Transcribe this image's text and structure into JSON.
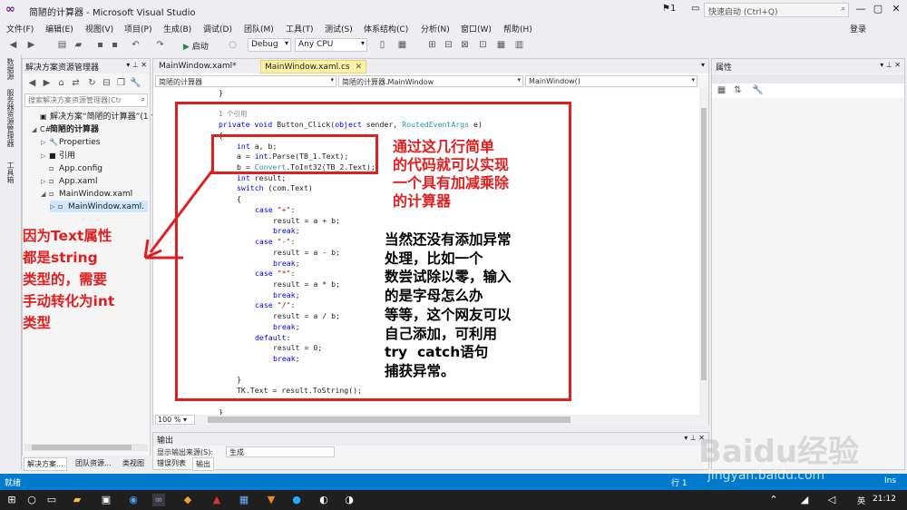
{
  "window": {
    "title": "简陋的计算器 - Microsoft Visual Studio",
    "flag_count": "1",
    "quick_launch_placeholder": "快速启动 (Ctrl+Q)",
    "login": "登录"
  },
  "menu": [
    "文件(F)",
    "编辑(E)",
    "视图(V)",
    "项目(P)",
    "生成(B)",
    "调试(D)",
    "团队(M)",
    "工具(T)",
    "测试(S)",
    "体系结构(C)",
    "分析(N)",
    "窗口(W)",
    "帮助(H)"
  ],
  "toolbar": {
    "start_label": "启动",
    "config": "Debug",
    "platform": "Any CPU"
  },
  "left_strip": [
    "数据源",
    "服务器资源管理器",
    "工具箱"
  ],
  "solution_explorer": {
    "title": "解决方案资源管理器",
    "search_placeholder": "搜索解决方案资源管理器(Ctr",
    "items": [
      {
        "label": "解决方案“简陋的计算器”(1 个",
        "arrow": "",
        "icon": "▣",
        "indent": 0
      },
      {
        "label": "简陋的计算器",
        "arrow": "◢",
        "icon": "C#",
        "indent": 0,
        "bold": true
      },
      {
        "label": "Properties",
        "arrow": "▷",
        "icon": "🔧",
        "indent": 1
      },
      {
        "label": "引用",
        "arrow": "▷",
        "icon": "■",
        "indent": 1
      },
      {
        "label": "App.config",
        "arrow": "",
        "icon": "▫",
        "indent": 1
      },
      {
        "label": "App.xaml",
        "arrow": "▷",
        "icon": "▫",
        "indent": 1
      },
      {
        "label": "MainWindow.xaml",
        "arrow": "◢",
        "icon": "▫",
        "indent": 1
      },
      {
        "label": "MainWindow.xaml.",
        "arrow": "▷",
        "icon": "▫",
        "indent": 2,
        "selected": true
      }
    ],
    "tabs": [
      "解决方案...",
      "团队资源...",
      "类视图"
    ]
  },
  "editor": {
    "tabs": [
      {
        "label": "MainWindow.xaml*",
        "active": false
      },
      {
        "label": "MainWindow.xaml.cs",
        "active": true
      }
    ],
    "nav": [
      "简陋的计算器",
      "简陋的计算器.MainWindow",
      "MainWindow()"
    ],
    "zoom": "100 %",
    "code": [
      {
        "indent": 4,
        "parts": [
          {
            "t": "}"
          }
        ]
      },
      {
        "indent": 0,
        "parts": [
          {
            "t": ""
          }
        ]
      },
      {
        "indent": 4,
        "parts": [
          {
            "t": "1 个引用",
            "c": "ref"
          }
        ]
      },
      {
        "indent": 4,
        "parts": [
          {
            "t": "private void ",
            "c": "kw"
          },
          {
            "t": "Button_Click("
          },
          {
            "t": "object",
            "c": "kw"
          },
          {
            "t": " sender, "
          },
          {
            "t": "RoutedEventArgs",
            "c": "ty"
          },
          {
            "t": " e)"
          }
        ]
      },
      {
        "indent": 4,
        "parts": [
          {
            "t": "{"
          }
        ]
      },
      {
        "indent": 8,
        "parts": [
          {
            "t": "int",
            "c": "kw"
          },
          {
            "t": " a, b;"
          }
        ]
      },
      {
        "indent": 8,
        "parts": [
          {
            "t": "a = "
          },
          {
            "t": "int",
            "c": "kw"
          },
          {
            "t": ".Parse(TB_1.Text);"
          }
        ]
      },
      {
        "indent": 8,
        "parts": [
          {
            "t": "b = "
          },
          {
            "t": "Convert",
            "c": "ty"
          },
          {
            "t": ".ToInt32(TB_2.Text);"
          }
        ]
      },
      {
        "indent": 8,
        "parts": [
          {
            "t": "int",
            "c": "kw"
          },
          {
            "t": " result;"
          }
        ]
      },
      {
        "indent": 8,
        "parts": [
          {
            "t": "switch",
            "c": "kw"
          },
          {
            "t": " (com.Text)"
          }
        ]
      },
      {
        "indent": 8,
        "parts": [
          {
            "t": "{"
          }
        ]
      },
      {
        "indent": 12,
        "parts": [
          {
            "t": "case ",
            "c": "kw"
          },
          {
            "t": "\"+\"",
            "c": "st"
          },
          {
            "t": ":"
          }
        ]
      },
      {
        "indent": 16,
        "parts": [
          {
            "t": "result = a + b;"
          }
        ]
      },
      {
        "indent": 16,
        "parts": [
          {
            "t": "break",
            "c": "kw"
          },
          {
            "t": ";"
          }
        ]
      },
      {
        "indent": 12,
        "parts": [
          {
            "t": "case ",
            "c": "kw"
          },
          {
            "t": "\"-\"",
            "c": "st"
          },
          {
            "t": ":"
          }
        ]
      },
      {
        "indent": 16,
        "parts": [
          {
            "t": "result = a - b;"
          }
        ]
      },
      {
        "indent": 16,
        "parts": [
          {
            "t": "break",
            "c": "kw"
          },
          {
            "t": ";"
          }
        ]
      },
      {
        "indent": 12,
        "parts": [
          {
            "t": "case ",
            "c": "kw"
          },
          {
            "t": "\"*\"",
            "c": "st"
          },
          {
            "t": ":"
          }
        ]
      },
      {
        "indent": 16,
        "parts": [
          {
            "t": "result = a * b;"
          }
        ]
      },
      {
        "indent": 16,
        "parts": [
          {
            "t": "break",
            "c": "kw"
          },
          {
            "t": ";"
          }
        ]
      },
      {
        "indent": 12,
        "parts": [
          {
            "t": "case ",
            "c": "kw"
          },
          {
            "t": "\"/\"",
            "c": "st"
          },
          {
            "t": ":"
          }
        ]
      },
      {
        "indent": 16,
        "parts": [
          {
            "t": "result = a / b;"
          }
        ]
      },
      {
        "indent": 16,
        "parts": [
          {
            "t": "break",
            "c": "kw"
          },
          {
            "t": ";"
          }
        ]
      },
      {
        "indent": 12,
        "parts": [
          {
            "t": "default",
            "c": "kw"
          },
          {
            "t": ":"
          }
        ]
      },
      {
        "indent": 16,
        "parts": [
          {
            "t": "result = 0;"
          }
        ]
      },
      {
        "indent": 16,
        "parts": [
          {
            "t": "break",
            "c": "kw"
          },
          {
            "t": ";"
          }
        ]
      },
      {
        "indent": 0,
        "parts": [
          {
            "t": ""
          }
        ]
      },
      {
        "indent": 8,
        "parts": [
          {
            "t": "}"
          }
        ]
      },
      {
        "indent": 8,
        "parts": [
          {
            "t": "TK.Text = result.ToString();"
          }
        ]
      },
      {
        "indent": 0,
        "parts": [
          {
            "t": ""
          }
        ]
      },
      {
        "indent": 4,
        "parts": [
          {
            "t": "}"
          }
        ]
      }
    ]
  },
  "annotations": {
    "top_right": "通过这几行简单\n的代码就可以实现\n一个具有加减乘除\n的计算器",
    "bottom_right": "当然还没有添加异常\n处理，比如一个\n数尝试除以零，输入\n的是字母怎么办\n等等，这个网友可以\n自己添加，可利用\ntry  catch语句\n捕获异常。",
    "left": "因为Text属性\n都是string\n类型的，需要\n手动转化为int\n类型",
    "red": "#e02020",
    "black": "#000000"
  },
  "output": {
    "title": "输出",
    "source_label": "显示输出来源(S):",
    "source_value": "生成",
    "tabs": [
      "错误列表",
      "输出"
    ]
  },
  "properties": {
    "title": "属性"
  },
  "status": {
    "ready": "就绪",
    "line": "行 1",
    "ins": "Ins"
  },
  "taskbar": {
    "ime": "英",
    "clock": "21:12"
  },
  "watermark": {
    "brand": "Baidu经验",
    "url": "jingyan.baidu.com"
  },
  "colors": {
    "accent": "#007acc",
    "vs_purple": "#68217a",
    "tab_active": "#fff1a8"
  }
}
